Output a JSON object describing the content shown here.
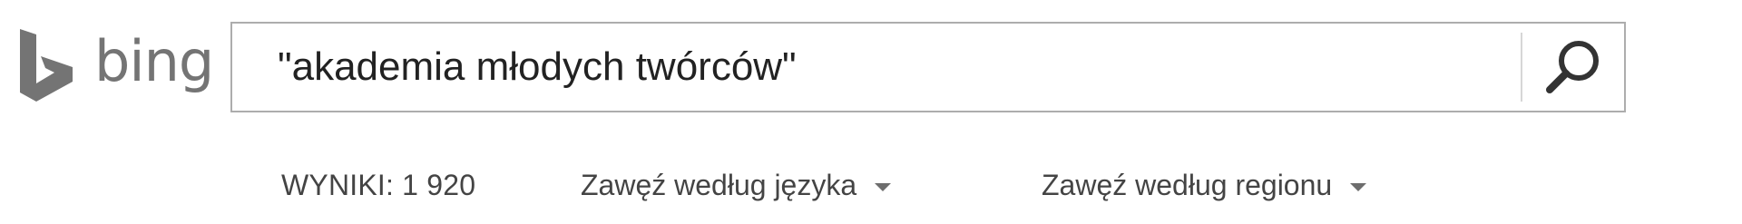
{
  "logo": {
    "text": "bing",
    "icon": "bing-b-logo-icon"
  },
  "search": {
    "query": "\"akademia młodych twórców\"",
    "button_icon": "search-magnifier-icon"
  },
  "filters": {
    "results_count": "WYNIKI: 1 920",
    "language": {
      "label": "Zawęź według języka",
      "icon": "chevron-down-icon"
    },
    "region": {
      "label": "Zawęź według regionu",
      "icon": "chevron-down-icon"
    }
  },
  "colors": {
    "logo": "#747474",
    "text": "#444444",
    "border": "#adadad"
  }
}
